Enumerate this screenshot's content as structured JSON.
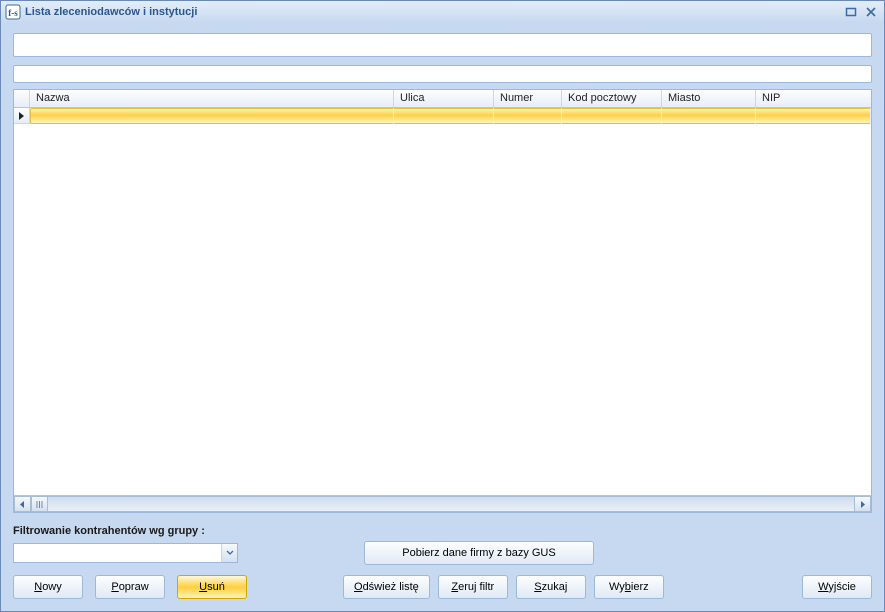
{
  "window": {
    "title": "Lista zleceniodawców i instytucji"
  },
  "inputs": {
    "search_top": "",
    "search_second": ""
  },
  "grid": {
    "columns": {
      "nazwa": "Nazwa",
      "ulica": "Ulica",
      "numer": "Numer",
      "kod": "Kod pocztowy",
      "miasto": "Miasto",
      "nip": "NIP"
    },
    "rows": [
      {
        "nazwa": "",
        "ulica": "",
        "numer": "",
        "kod": "",
        "miasto": "",
        "nip": "",
        "selected": true
      }
    ]
  },
  "filter": {
    "label": "Filtrowanie kontrahentów wg grupy :",
    "value": ""
  },
  "buttons": {
    "gus": "Pobierz dane firmy z bazy GUS",
    "nowy_pre": "N",
    "nowy_post": "owy",
    "popraw_pre": "P",
    "popraw_post": "opraw",
    "usun_pre": "U",
    "usun_post": "suń",
    "odswiez_pre": "O",
    "odswiez_post": "dśwież listę",
    "zeruj_pre": "Z",
    "zeruj_post": "eruj filtr",
    "szukaj_pre": "S",
    "szukaj_post": "zukaj",
    "wybierz_pre": "Wy",
    "wybierz_u": "b",
    "wybierz_post": "ierz",
    "wyjscie_pre": "W",
    "wyjscie_post": "yjście"
  }
}
